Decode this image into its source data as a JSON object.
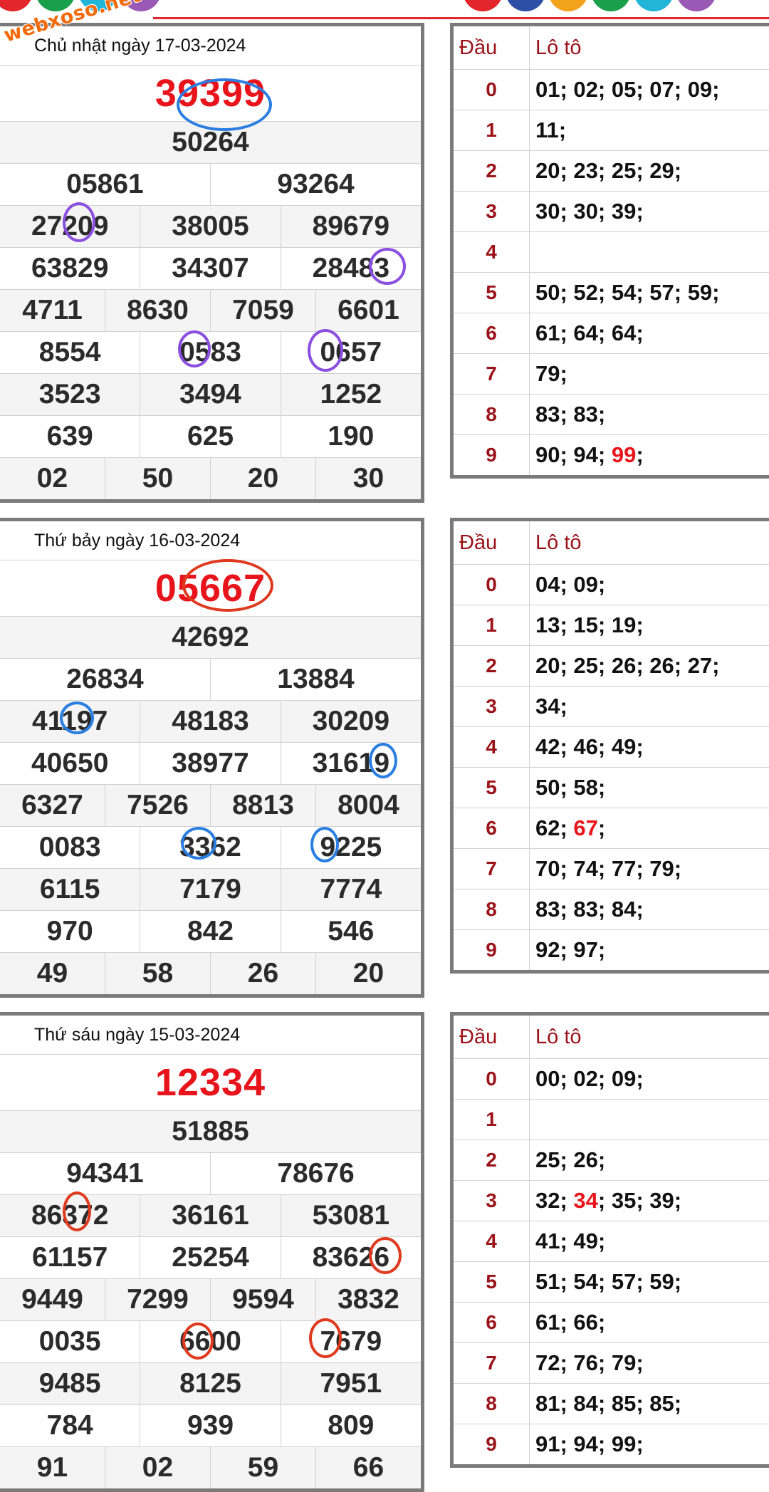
{
  "brand": {
    "logo_text": "webxoso.net"
  },
  "colors": {
    "red": "#e8141b",
    "dark_red": "#9b1218",
    "border": "#7a7a7a",
    "blue_mark": "#2a7de1",
    "purple_mark": "#8b4fe0",
    "orange_mark": "#e03a1e"
  },
  "draws": [
    {
      "date": "Chủ nhật ngày 17-03-2024",
      "special": "39399",
      "first": [
        "50264"
      ],
      "second": [
        "05861",
        "93264"
      ],
      "third": [
        [
          "27209",
          "38005",
          "89679"
        ],
        [
          "63829",
          "34307",
          "28483"
        ]
      ],
      "fourth": [
        "4711",
        "8630",
        "7059",
        "6601"
      ],
      "fifth": [
        [
          "8554",
          "0583",
          "0657"
        ],
        [
          "3523",
          "3494",
          "1252"
        ]
      ],
      "sixth": [
        "639",
        "625",
        "190"
      ],
      "seventh": [
        "02",
        "50",
        "20",
        "30"
      ],
      "loto_header": {
        "dau": "Đầu",
        "loto": "Lô tô"
      },
      "loto": [
        {
          "d": "0",
          "v": [
            "01",
            "02",
            "05",
            "07",
            "09"
          ]
        },
        {
          "d": "1",
          "v": [
            "11"
          ]
        },
        {
          "d": "2",
          "v": [
            "20",
            "23",
            "25",
            "29"
          ]
        },
        {
          "d": "3",
          "v": [
            "30",
            "30",
            "39"
          ]
        },
        {
          "d": "4",
          "v": []
        },
        {
          "d": "5",
          "v": [
            "50",
            "52",
            "54",
            "57",
            "59"
          ]
        },
        {
          "d": "6",
          "v": [
            "61",
            "64",
            "64"
          ]
        },
        {
          "d": "7",
          "v": [
            "79"
          ]
        },
        {
          "d": "8",
          "v": [
            "83",
            "83"
          ]
        },
        {
          "d": "9",
          "v": [
            "90",
            "94",
            "99"
          ]
        }
      ],
      "highlight": "99"
    },
    {
      "date": "Thứ bảy ngày 16-03-2024",
      "special": "05667",
      "first": [
        "42692"
      ],
      "second": [
        "26834",
        "13884"
      ],
      "third": [
        [
          "41197",
          "48183",
          "30209"
        ],
        [
          "40650",
          "38977",
          "31619"
        ]
      ],
      "fourth": [
        "6327",
        "7526",
        "8813",
        "8004"
      ],
      "fifth": [
        [
          "0083",
          "3362",
          "9225"
        ],
        [
          "6115",
          "7179",
          "7774"
        ]
      ],
      "sixth": [
        "970",
        "842",
        "546"
      ],
      "seventh": [
        "49",
        "58",
        "26",
        "20"
      ],
      "loto_header": {
        "dau": "Đầu",
        "loto": "Lô tô"
      },
      "loto": [
        {
          "d": "0",
          "v": [
            "04",
            "09"
          ]
        },
        {
          "d": "1",
          "v": [
            "13",
            "15",
            "19"
          ]
        },
        {
          "d": "2",
          "v": [
            "20",
            "25",
            "26",
            "26",
            "27"
          ]
        },
        {
          "d": "3",
          "v": [
            "34"
          ]
        },
        {
          "d": "4",
          "v": [
            "42",
            "46",
            "49"
          ]
        },
        {
          "d": "5",
          "v": [
            "50",
            "58"
          ]
        },
        {
          "d": "6",
          "v": [
            "62",
            "67"
          ]
        },
        {
          "d": "7",
          "v": [
            "70",
            "74",
            "77",
            "79"
          ]
        },
        {
          "d": "8",
          "v": [
            "83",
            "83",
            "84"
          ]
        },
        {
          "d": "9",
          "v": [
            "92",
            "97"
          ]
        }
      ],
      "highlight": "67"
    },
    {
      "date": "Thứ sáu ngày 15-03-2024",
      "special": "12334",
      "first": [
        "51885"
      ],
      "second": [
        "94341",
        "78676"
      ],
      "third": [
        [
          "86372",
          "36161",
          "53081"
        ],
        [
          "61157",
          "25254",
          "83626"
        ]
      ],
      "fourth": [
        "9449",
        "7299",
        "9594",
        "3832"
      ],
      "fifth": [
        [
          "0035",
          "6600",
          "7679"
        ],
        [
          "9485",
          "8125",
          "7951"
        ]
      ],
      "sixth": [
        "784",
        "939",
        "809"
      ],
      "seventh": [
        "91",
        "02",
        "59",
        "66"
      ],
      "loto_header": {
        "dau": "Đầu",
        "loto": "Lô tô"
      },
      "loto": [
        {
          "d": "0",
          "v": [
            "00",
            "02",
            "09"
          ]
        },
        {
          "d": "1",
          "v": []
        },
        {
          "d": "2",
          "v": [
            "25",
            "26"
          ]
        },
        {
          "d": "3",
          "v": [
            "32",
            "34",
            "35",
            "39"
          ]
        },
        {
          "d": "4",
          "v": [
            "41",
            "49"
          ]
        },
        {
          "d": "5",
          "v": [
            "51",
            "54",
            "57",
            "59"
          ]
        },
        {
          "d": "6",
          "v": [
            "61",
            "66"
          ]
        },
        {
          "d": "7",
          "v": [
            "72",
            "76",
            "79"
          ]
        },
        {
          "d": "8",
          "v": [
            "81",
            "84",
            "85",
            "85"
          ]
        },
        {
          "d": "9",
          "v": [
            "91",
            "94",
            "99"
          ]
        }
      ],
      "highlight": "34"
    }
  ]
}
